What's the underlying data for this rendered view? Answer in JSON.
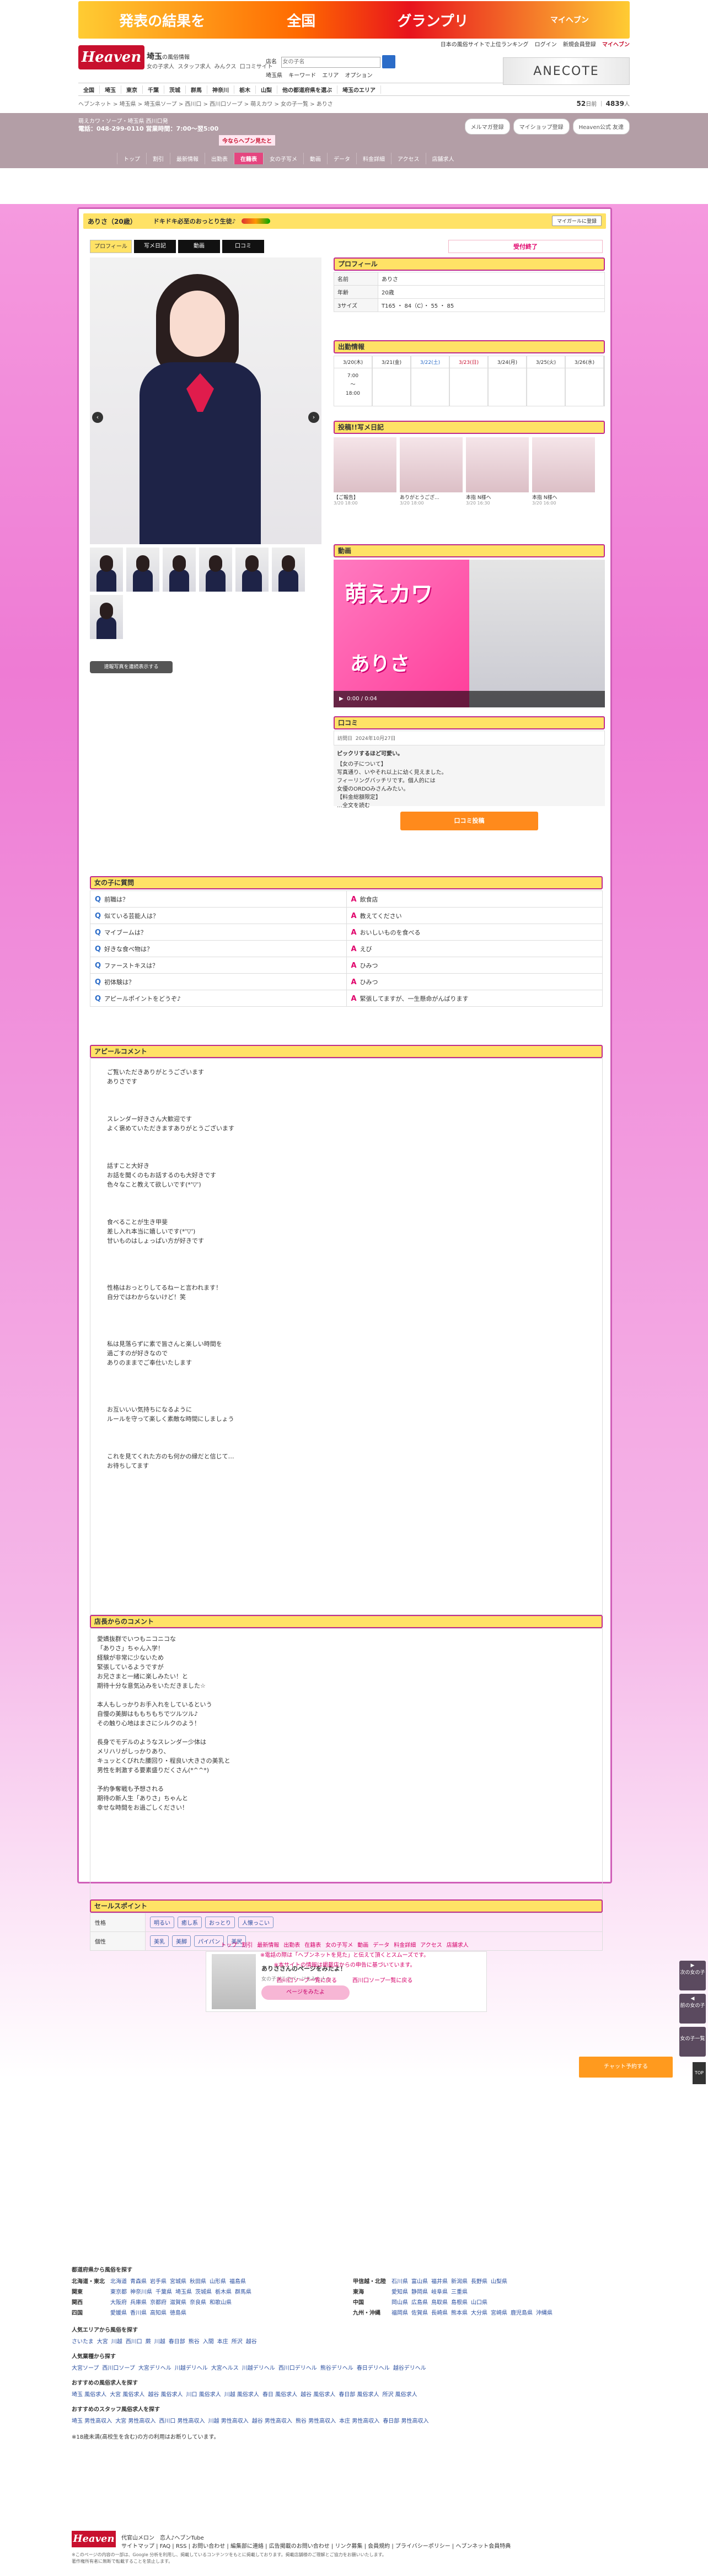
{
  "banner": {
    "left_text": "発表の結果を",
    "right_text": "グランプリ",
    "sub": "全国",
    "tag": "マイヘブン"
  },
  "header": {
    "logo": "Heaven",
    "region": "埼玉",
    "region_sub": "の風俗情報",
    "sub_links": [
      "女の子求人",
      "スタッフ求人",
      "みんクス",
      "口コミサイト"
    ],
    "top_right": [
      "日本の風俗サイトで上位ランキング",
      "ログイン",
      "新規会員登録"
    ],
    "myheaven": "マイヘブン",
    "search_label": "店名",
    "search_placeholder": "女の子名",
    "chips": [
      "埼玉県",
      "キーワード",
      "エリア",
      "オプション"
    ],
    "ad": "ANECOTE"
  },
  "nav": [
    "全国",
    "埼玉",
    "東京",
    "千葉",
    "茨城",
    "群馬",
    "神奈川",
    "栃木",
    "山梨",
    "他の都道府県を選ぶ",
    "埼玉のエリア"
  ],
  "breadcrumb": "ヘブンネット > 埼玉県 > 埼玉県ソープ > 西川口 > 西川口ソープ > 萌えカワ > 女の子一覧 > ありさ",
  "count": {
    "label1": "52",
    "unit1": "日前",
    "label2": "4839",
    "unit2": "人"
  },
  "shop": {
    "line1": "萌えカワ・ソープ・埼玉県 西川口発",
    "line2": "電話：048-299-0110 営業時間：7:00～翌5:00",
    "now": "今ならヘブン見たと",
    "buttons": [
      "メルマガ登録",
      "マイショップ登録",
      "Heaven公式 友達"
    ],
    "tabs": [
      "トップ",
      "割引",
      "最新情報",
      "出勤表",
      "在籍表",
      "女の子写メ",
      "動画",
      "データ",
      "料金詳細",
      "アクセス",
      "店舗求人"
    ],
    "active_tab": "在籍表",
    "new_badge": "NEW"
  },
  "girl": {
    "name": "ありさ（20歳）",
    "catch": "ドキドキ必至のおっとり生徒♪",
    "mypage_btn": "マイガールに登録",
    "tabs": [
      "プロフィール",
      "写メ日記",
      "動画",
      "口コミ"
    ],
    "status": "受付終了",
    "slideshow": "速報写真を連続表示する"
  },
  "profile": {
    "heading": "プロフィール",
    "rows": [
      {
        "k": "名前",
        "v": "ありさ"
      },
      {
        "k": "年齢",
        "v": "20歳"
      },
      {
        "k": "3サイズ",
        "v": "T165 ・ 84（C）・ 55 ・ 85"
      }
    ]
  },
  "schedule": {
    "heading": "出勤情報",
    "days": [
      "3/20(木)",
      "3/21(金)",
      "3/22(土)",
      "3/23(日)",
      "3/24(月)",
      "3/25(火)",
      "3/26(水)"
    ],
    "values": [
      "7:00\n～\n18:00",
      "",
      "",
      "",
      "",
      "",
      ""
    ]
  },
  "diary": {
    "heading": "投稿!!写メ日記",
    "items": [
      {
        "cap": "【ご報告】",
        "dt": "3/20 18:00"
      },
      {
        "cap": "ありがとうござ...",
        "dt": "3/20 18:00"
      },
      {
        "cap": "本指 N様へ",
        "dt": "3/20 16:30"
      },
      {
        "cap": "本指 N様へ",
        "dt": "3/20 16:00"
      }
    ]
  },
  "video": {
    "heading": "動画",
    "logo": "萌えカワ",
    "name": "ありさ",
    "time": "0:00 / 0:04"
  },
  "review": {
    "heading": "口コミ",
    "meta_label": "訪問日",
    "meta_date": "2024年10月27日",
    "title": "ピックリするほど可愛い。",
    "body": "【女の子について】\n写真通り、いやそれ以上に幼く見えました。\nフィーリングバッチリです。個人的には\n女優のORDOみさんみたい。\n【料金総額限定】\n…全文を読む",
    "post": "口コミ投稿"
  },
  "qa": {
    "heading": "女の子に質問",
    "rows": [
      {
        "q": "前職は？",
        "a": "飲食店"
      },
      {
        "q": "似ている芸能人は？",
        "a": "教えてください"
      },
      {
        "q": "マイブームは？",
        "a": "おいしいものを食べる"
      },
      {
        "q": "好きな食べ物は？",
        "a": "えび"
      },
      {
        "q": "ファーストキスは？",
        "a": "ひみつ"
      },
      {
        "q": "初体験は？",
        "a": "ひみつ"
      },
      {
        "q": "アピールポイントをどうぞ♪",
        "a": "緊張してますが、一生懸命がんばります"
      }
    ]
  },
  "appeal": {
    "heading": "アピールコメント",
    "text": "ご覧いただきありがとうございます\nありさです\n\n\n\nスレンダー好きさん大歓迎です\nよく褒めていただきますありがとうございます\n\n\n\n話すこと大好き\nお話を聞くのもお話するのも大好きです\n色々なこと教えて欲しいです(*'▽')\n\n\n\n食べることが生き甲斐\n差し入れ本当に嬉しいです(*'▽')\n甘いものはしょっぱい方が好きです\n\n\n\n\n性格はおっとりしてるねーと言われます！\n自分ではわからないけど！笑\n\n\n\n\n私は見落らずに素で皆さんと楽しい時間を\n過ごすのが好きなので\nありのままでご奉仕いたします\n\n\n\n\nお互いいい気持ちになるように\nルールを守って楽しく素敵な時間にしましょう\n\n\n\nこれを見てくれた方のも何かの縁だと信じて…\nお待ちしてます"
  },
  "shop_comment": {
    "heading": "店長からのコメント",
    "text": "愛嬌抜群でいつもニコニコな\n「ありさ」ちゃん入学！\n経験が非常に少ないため\n緊張しているようですが\nお兄さまと一緒に楽しみたい！と\n期待十分な意気込みをいただきました☆\n\n本人もしっかりお手入れをしているという\n自慢の美脚はももちもちでツルツル♪\nその触り心地はまさにシルクのよう！\n\n長身でモデルのようなスレンダー少体は\nメリハリがしっかりあり、\nキュッとくびれた腰回り・程良い大きさの美乳と\n男性を刺激する要素盛りだくさん(*^^*)\n\n予約争奪戦も予想される\n期待の新人生「ありさ」ちゃんと\n幸せな時間をお過ごしください！"
  },
  "sales": {
    "heading": "セールスポイント",
    "rows": [
      {
        "k": "性格",
        "tags": [
          "明るい",
          "癒し系",
          "おっとり",
          "人懐っこい"
        ]
      },
      {
        "k": "個性",
        "tags": [
          "美乳",
          "美脚",
          "パイパン",
          "美尻"
        ]
      }
    ]
  },
  "mypage": {
    "t1": "ありささんのページをみたよ！",
    "t2": "女の子がこのページをみた人へ",
    "btn": "ページをみたよ"
  },
  "bottom_tabs": [
    "トップ",
    "割引",
    "最新情報",
    "出勤表",
    "在籍表",
    "女の子写メ",
    "動画",
    "データ",
    "料金詳細",
    "アクセス",
    "店舗求人"
  ],
  "bottom_notes": [
    "※電話の際は「ヘブンネットを見た」と伝えて頂くとスムーズです。",
    "※本サイトの情報は掲載店からの申告に基づいています。"
  ],
  "bottom_links": [
    "西川口ソープ一覧に戻る",
    "西川口ソープ一覧に戻る"
  ],
  "side": {
    "next": "次の女の子",
    "prev": "前の女の子",
    "list": "女の子一覧",
    "top": "TOP"
  },
  "notify": "チャット予約する",
  "footer": {
    "h1": "都道府県から風俗を探す",
    "regions_left": [
      {
        "k": "北海道・東北",
        "v": [
          "北海道",
          "青森県",
          "岩手県",
          "宮城県",
          "秋田県",
          "山形県",
          "福島県"
        ]
      },
      {
        "k": "関東",
        "v": [
          "東京都",
          "神奈川県",
          "千葉県",
          "埼玉県",
          "茨城県",
          "栃木県",
          "群馬県"
        ]
      },
      {
        "k": "関西",
        "v": [
          "大阪府",
          "兵庫県",
          "京都府",
          "滋賀県",
          "奈良県",
          "和歌山県"
        ]
      },
      {
        "k": "四国",
        "v": [
          "愛媛県",
          "香川県",
          "高知県",
          "徳島県"
        ]
      }
    ],
    "regions_right": [
      {
        "k": "甲信越・北陸",
        "v": [
          "石川県",
          "富山県",
          "福井県",
          "新潟県",
          "長野県",
          "山梨県"
        ]
      },
      {
        "k": "東海",
        "v": [
          "愛知県",
          "静岡県",
          "岐阜県",
          "三重県"
        ]
      },
      {
        "k": "中国",
        "v": [
          "岡山県",
          "広島県",
          "鳥取県",
          "島根県",
          "山口県"
        ]
      },
      {
        "k": "九州・沖縄",
        "v": [
          "福岡県",
          "佐賀県",
          "長崎県",
          "熊本県",
          "大分県",
          "宮崎県",
          "鹿児島県",
          "沖縄県"
        ]
      }
    ],
    "h2": "人気エリアから風俗を探す",
    "area_line": [
      "さいたま",
      "大宮",
      "川越",
      "西川口",
      "蕨",
      "川越",
      "春日部",
      "熊谷",
      "入間",
      "本庄",
      "所沢",
      "越谷"
    ],
    "h3": "人気業種から探す",
    "gyo_line": [
      "大宮ソープ",
      "西川口ソープ",
      "大宮デリヘル",
      "川越デリヘル",
      "大宮ヘルス",
      "川越デリヘル",
      "西川口デリヘル",
      "熊谷デリヘル",
      "春日デリヘル",
      "越谷デリヘル"
    ],
    "h4": "おすすめの風俗求人を探す",
    "kyujin_line": [
      "埼玉 風俗求人",
      "大宮 風俗求人",
      "越谷 風俗求人",
      "川口 風俗求人",
      "川越 風俗求人",
      "春日 風俗求人",
      "越谷 風俗求人",
      "春日部 風俗求人",
      "所沢 風俗求人"
    ],
    "h5": "おすすめのスタッフ風俗求人を探す",
    "staff_line": [
      "埼玉 男性高収入",
      "大宮 男性高収入",
      "西川口 男性高収入",
      "川越 男性高収入",
      "越谷 男性高収入",
      "熊谷 男性高収入",
      "本庄 男性高収入",
      "春日部 男性高収入"
    ],
    "note": "※18歳未満(高校生を含む)の方の利用はお断りしています。",
    "links": [
      "代官山メロン",
      "恋人♪ヘブンTube",
      "サイトマップ",
      "FAQ",
      "RSS",
      "お問い合わせ",
      "編集部に連絡",
      "広告掲載のお問い合わせ",
      "リンク募集",
      "会員規約",
      "プライバシーポリシー",
      "ヘブンネット会員特典"
    ],
    "copyright": "※このページの内容の一部は、Google 分析を利用し、掲載しているコンテンツをもとに掲載しております。掲載店舗様のご理解とご協力をお願いいたします。\n著作権所有者に無断で転載することを禁止します。"
  }
}
